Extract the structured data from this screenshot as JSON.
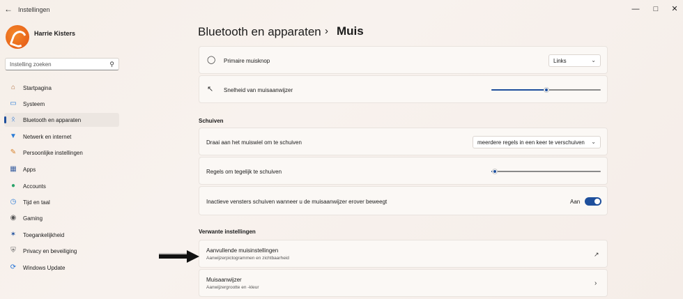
{
  "window": {
    "title": "Instellingen"
  },
  "user": {
    "name": "Harrie Kisters"
  },
  "search": {
    "placeholder": "Instelling zoeken"
  },
  "sidebar": {
    "items": [
      {
        "label": "Startpagina",
        "icon": "home-icon"
      },
      {
        "label": "Systeem",
        "icon": "monitor-icon"
      },
      {
        "label": "Bluetooth en apparaten",
        "icon": "bluetooth-icon",
        "selected": true
      },
      {
        "label": "Netwerk en internet",
        "icon": "wifi-icon"
      },
      {
        "label": "Persoonlijke instellingen",
        "icon": "brush-icon"
      },
      {
        "label": "Apps",
        "icon": "apps-icon"
      },
      {
        "label": "Accounts",
        "icon": "person-icon"
      },
      {
        "label": "Tijd en taal",
        "icon": "globe-clock-icon"
      },
      {
        "label": "Gaming",
        "icon": "gamepad-icon"
      },
      {
        "label": "Toegankelijkheid",
        "icon": "accessibility-icon"
      },
      {
        "label": "Privacy en beveiliging",
        "icon": "shield-icon"
      },
      {
        "label": "Windows Update",
        "icon": "update-icon"
      }
    ]
  },
  "breadcrumb": {
    "parent": "Bluetooth en apparaten",
    "separator": "›",
    "current": "Muis"
  },
  "rows": {
    "primary_button": {
      "label": "Primaire muisknop",
      "value": "Links"
    },
    "pointer_speed": {
      "label": "Snelheid van muisaanwijzer",
      "level": 0.5
    },
    "scroll_mode": {
      "label": "Draai aan het muiswiel om te schuiven",
      "value": "meerdere regels in een keer te verschuiven"
    },
    "scroll_lines": {
      "label": "Regels om tegelijk te schuiven",
      "level": 0.03
    },
    "inactive_scroll": {
      "label": "Inactieve vensters schuiven wanneer u de muisaanwijzer erover beweegt",
      "state": "Aan"
    },
    "more_mouse": {
      "label": "Aanvullende muisinstellingen",
      "sub": "Aanwijzerpictogrammen en zichtbaarheid"
    },
    "pointer": {
      "label": "Muisaanwijzer",
      "sub": "Aanwijzergrootte en -kleur"
    }
  },
  "sections": {
    "scroll": "Schuiven",
    "related": "Verwante instellingen"
  },
  "colors": {
    "accent": "#1e4f9c",
    "avatar": "#e8631a"
  }
}
